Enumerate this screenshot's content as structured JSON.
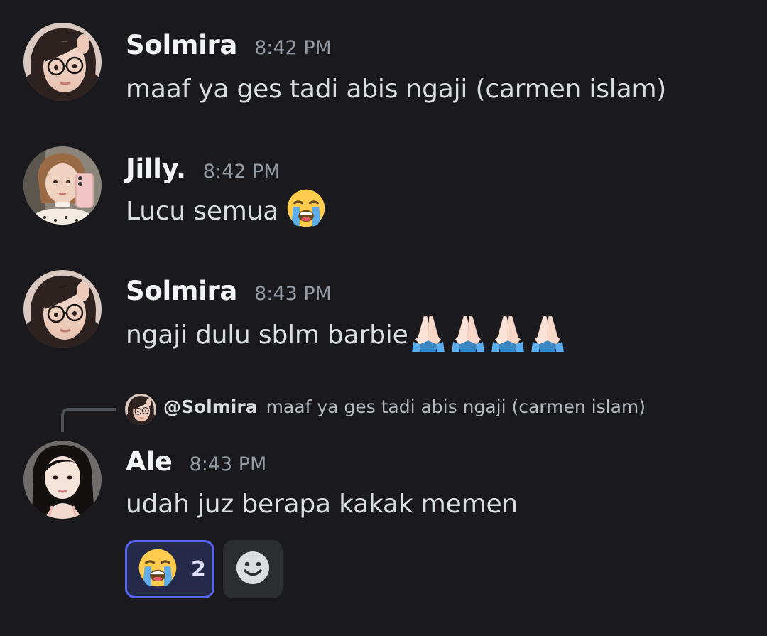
{
  "messages": [
    {
      "username": "Solmira",
      "timestamp": "8:42 PM",
      "text": "maaf ya ges tadi abis ngaji (carmen islam)",
      "avatar_icon": "avatar-photo"
    },
    {
      "username": "Jilly.",
      "timestamp": "8:42 PM",
      "text": "Lucu semua",
      "emoji": "loudly-crying-face-icon",
      "avatar_icon": "avatar-photo"
    },
    {
      "username": "Solmira",
      "timestamp": "8:43 PM",
      "text": "ngaji dulu sblm barbie",
      "emoji": "folded-hands-icon",
      "emoji_count": 4,
      "avatar_icon": "avatar-photo"
    },
    {
      "username": "Ale",
      "timestamp": "8:43 PM",
      "text": "udah juz berapa kakak memen",
      "avatar_icon": "avatar-photo",
      "reply_to": {
        "user": "@Solmira",
        "snippet": "maaf ya ges tadi abis ngaji (carmen islam)"
      },
      "reactions": [
        {
          "emoji": "loudly-crying-face-icon",
          "count": "2",
          "selected": true
        }
      ]
    }
  ],
  "colors": {
    "background": "#1a1a1e",
    "username": "#f2f3f5",
    "timestamp": "#949ba4",
    "text": "#dbdee1",
    "reaction_border": "#5865f2",
    "reaction_bg": "#262a4a"
  }
}
